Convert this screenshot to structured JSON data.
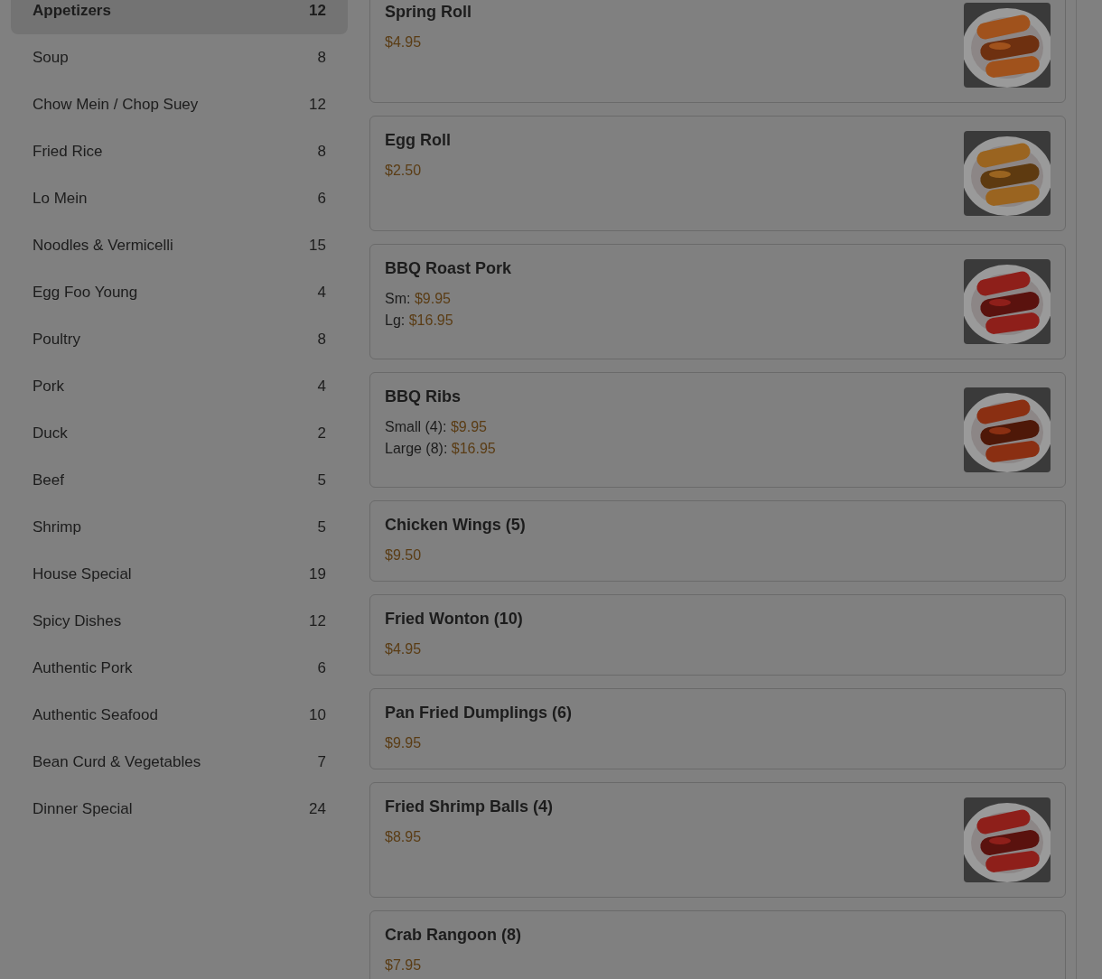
{
  "sidebar": {
    "items": [
      {
        "label": "Appetizers",
        "count": "12",
        "selected": true
      },
      {
        "label": "Soup",
        "count": "8",
        "selected": false
      },
      {
        "label": "Chow Mein / Chop Suey",
        "count": "12",
        "selected": false
      },
      {
        "label": "Fried Rice",
        "count": "8",
        "selected": false
      },
      {
        "label": "Lo Mein",
        "count": "6",
        "selected": false
      },
      {
        "label": "Noodles & Vermicelli",
        "count": "15",
        "selected": false
      },
      {
        "label": "Egg Foo Young",
        "count": "4",
        "selected": false
      },
      {
        "label": "Poultry",
        "count": "8",
        "selected": false
      },
      {
        "label": "Pork",
        "count": "4",
        "selected": false
      },
      {
        "label": "Duck",
        "count": "2",
        "selected": false
      },
      {
        "label": "Beef",
        "count": "5",
        "selected": false
      },
      {
        "label": "Shrimp",
        "count": "5",
        "selected": false
      },
      {
        "label": "House Special",
        "count": "19",
        "selected": false
      },
      {
        "label": "Spicy Dishes",
        "count": "12",
        "selected": false
      },
      {
        "label": "Authentic Pork",
        "count": "6",
        "selected": false
      },
      {
        "label": "Authentic Seafood",
        "count": "10",
        "selected": false
      },
      {
        "label": "Bean Curd & Vegetables",
        "count": "7",
        "selected": false
      },
      {
        "label": "Dinner Special",
        "count": "24",
        "selected": false
      }
    ]
  },
  "menu_items": [
    {
      "name": "Spring Roll",
      "prices": [
        {
          "price": "$4.95"
        }
      ],
      "photo": {
        "kind": "picture"
      }
    },
    {
      "name": "Egg Roll",
      "prices": [
        {
          "price": "$2.50"
        }
      ],
      "photo": {
        "kind": "picture"
      }
    },
    {
      "name": "BBQ Roast Pork",
      "prices": [
        {
          "label": "Sm:",
          "price": "$9.95"
        },
        {
          "label": "Lg:",
          "price": "$16.95"
        }
      ],
      "photo": {
        "kind": "picture"
      }
    },
    {
      "name": "BBQ Ribs",
      "prices": [
        {
          "label": "Small (4):",
          "price": "$9.95"
        },
        {
          "label": "Large (8):",
          "price": "$16.95"
        }
      ],
      "photo": {
        "kind": "picture"
      }
    },
    {
      "name": "Chicken Wings (5)",
      "prices": [
        {
          "price": "$9.50"
        }
      ]
    },
    {
      "name": "Fried Wonton (10)",
      "prices": [
        {
          "price": "$4.95"
        }
      ]
    },
    {
      "name": "Pan Fried Dumplings (6)",
      "prices": [
        {
          "price": "$9.95"
        }
      ]
    },
    {
      "name": "Fried Shrimp Balls (4)",
      "prices": [
        {
          "price": "$8.95"
        }
      ],
      "photo": {
        "kind": "picture"
      }
    },
    {
      "name": "Crab Rangoon (8)",
      "prices": [
        {
          "price": "$7.95"
        }
      ]
    }
  ]
}
